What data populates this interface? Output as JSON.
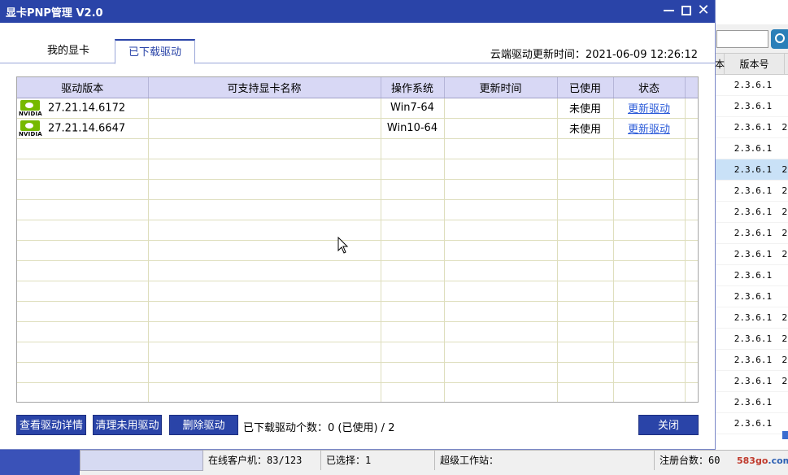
{
  "window": {
    "title": "显卡PNP管理 V2.0"
  },
  "tabs": [
    {
      "label": "我的显卡",
      "active": false
    },
    {
      "label": "已下载驱动",
      "active": true
    }
  ],
  "cloud_update": "云端驱动更新时间：2021-06-09 12:26:12",
  "table": {
    "columns": [
      "驱动版本",
      "可支持显卡名称",
      "操作系统",
      "更新时间",
      "已使用",
      "状态"
    ],
    "rows": [
      {
        "icon": "nvidia-logo-icon",
        "logo_text": "NVIDIA",
        "version": "27.21.14.6172",
        "cards": "",
        "os": "Win7-64",
        "updated": "",
        "used": "未使用",
        "status": "更新驱动"
      },
      {
        "icon": "nvidia-logo-icon",
        "logo_text": "NVIDIA",
        "version": "27.21.14.6647",
        "cards": "",
        "os": "Win10-64",
        "updated": "",
        "used": "未使用",
        "status": "更新驱动"
      }
    ]
  },
  "footer": {
    "detail_button": "查看驱动详情",
    "clean_button": "清理未用驱动",
    "delete_button": "删除驱动",
    "count_text": "已下载驱动个数：0 (已使用) / 2",
    "close_button": "关闭"
  },
  "background": {
    "column_header": "版本号",
    "column_header_prefix": "本",
    "versions": [
      "2.3.6.1",
      "2.3.6.1",
      "2.3.6.1",
      "2.3.6.1",
      "2.3.6.1",
      "2.3.6.1",
      "2.3.6.1",
      "2.3.6.1",
      "2.3.6.1",
      "2.3.6.1",
      "2.3.6.1",
      "2.3.6.1",
      "2.3.6.1",
      "2.3.6.1",
      "2.3.6.1",
      "2.3.6.1",
      "2.3.6.1"
    ],
    "trailing": [
      "",
      "",
      "2",
      "",
      "2",
      "2",
      "2",
      "2",
      "2",
      "",
      "",
      "2",
      "2",
      "2",
      "2",
      "",
      ""
    ],
    "selected_row": 4,
    "status": {
      "online": "在线客户机：83/123",
      "selected": "已选择：1",
      "super_station": "超级工作站：",
      "registered": "注册台数：60"
    },
    "watermark": {
      "a": "583go",
      "b": ".com"
    }
  },
  "colors": {
    "titlebar": "#2a44a8",
    "accent_button": "#2a44a8",
    "link": "#2a5ad8",
    "nvidia_green": "#76b900"
  }
}
